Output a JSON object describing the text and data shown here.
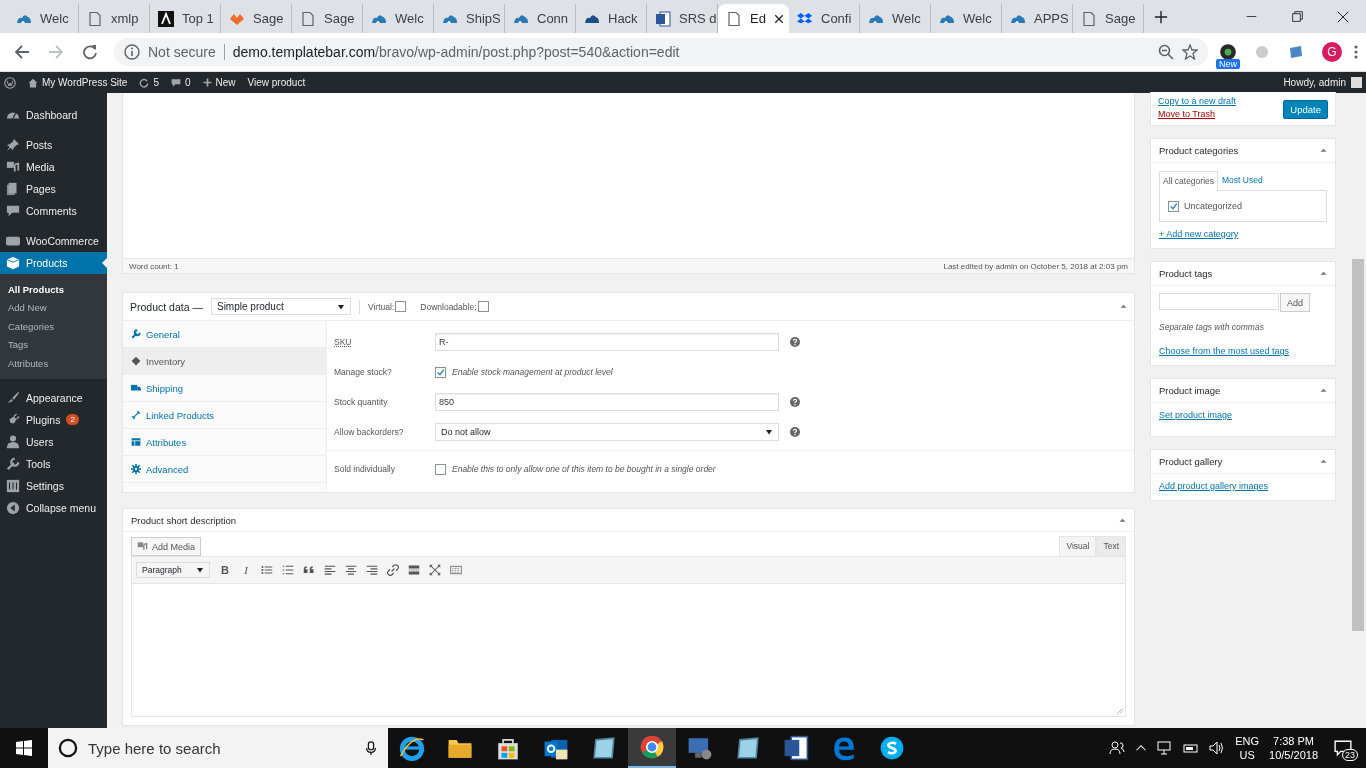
{
  "browser": {
    "tabs": [
      {
        "title": "Welc",
        "selected": false
      },
      {
        "title": "xmlp",
        "selected": false
      },
      {
        "title": "Top 1",
        "selected": false
      },
      {
        "title": "Sage",
        "selected": false
      },
      {
        "title": "Sage",
        "selected": false
      },
      {
        "title": "Welc",
        "selected": false
      },
      {
        "title": "ShipS",
        "selected": false
      },
      {
        "title": "Conn",
        "selected": false
      },
      {
        "title": "Hack",
        "selected": false
      },
      {
        "title": "SRS d",
        "selected": false
      },
      {
        "title": "Ed",
        "selected": true
      },
      {
        "title": "Confi",
        "selected": false
      },
      {
        "title": "Welc",
        "selected": false
      },
      {
        "title": "Welc",
        "selected": false
      },
      {
        "title": "APPS",
        "selected": false
      },
      {
        "title": "Sage",
        "selected": false
      }
    ],
    "security": "Not secure",
    "url_host": "demo.templatebar.com",
    "url_path": "/bravo/wp-admin/post.php?post=540&action=edit",
    "extension_badge": "New",
    "profile_initial": "G"
  },
  "admin_bar": {
    "site": "My WordPress Site",
    "updates": "5",
    "comments": "0",
    "new": "New",
    "view": "View product",
    "greeting": "Howdy, admin"
  },
  "sidebar": {
    "sections": [
      {
        "items": [
          {
            "label": "Dashboard",
            "selected": false
          }
        ]
      },
      {
        "items": [
          {
            "label": "Posts",
            "selected": false
          },
          {
            "label": "Media",
            "selected": false
          },
          {
            "label": "Pages",
            "selected": false
          },
          {
            "label": "Comments",
            "selected": false
          }
        ]
      },
      {
        "items": [
          {
            "label": "WooCommerce",
            "selected": false
          },
          {
            "label": "Products",
            "selected": true,
            "children": [
              {
                "label": "All Products",
                "selected": true
              },
              {
                "label": "Add New",
                "selected": false
              },
              {
                "label": "Categories",
                "selected": false
              },
              {
                "label": "Tags",
                "selected": false
              },
              {
                "label": "Attributes",
                "selected": false
              }
            ]
          }
        ]
      },
      {
        "items": [
          {
            "label": "Appearance",
            "selected": false
          },
          {
            "label": "Plugins",
            "selected": false,
            "badge": "2"
          },
          {
            "label": "Users",
            "selected": false
          },
          {
            "label": "Tools",
            "selected": false
          },
          {
            "label": "Settings",
            "selected": false
          },
          {
            "label": "Collapse menu",
            "selected": false
          }
        ]
      }
    ]
  },
  "editor": {
    "word_count": "Word count: 1",
    "last_edited": "Last edited by admin on October 5, 2018 at 2:03 pm"
  },
  "product_data": {
    "title": "Product data —",
    "type": "Simple product",
    "options": [
      {
        "label": "Virtual:",
        "checked": false
      },
      {
        "label": "Downloadable:",
        "checked": false
      }
    ],
    "tabs": [
      {
        "label": "General",
        "selected": false
      },
      {
        "label": "Inventory",
        "selected": true
      },
      {
        "label": "Shipping",
        "selected": false
      },
      {
        "label": "Linked Products",
        "selected": false
      },
      {
        "label": "Attributes",
        "selected": false
      },
      {
        "label": "Advanced",
        "selected": false
      }
    ],
    "groups": [
      [
        {
          "kind": "text",
          "label": "SKU",
          "value": "R-",
          "help": true
        },
        {
          "kind": "checkbox",
          "label": "Manage stock?",
          "checked": true,
          "description": "Enable stock management at product level",
          "help": false
        },
        {
          "kind": "text",
          "label": "Stock quantity",
          "value": "850",
          "help": true
        },
        {
          "kind": "select",
          "label": "Allow backorders?",
          "value": "Do not allow",
          "help": true
        }
      ],
      [
        {
          "kind": "checkbox",
          "label": "Sold individually",
          "checked": false,
          "description": "Enable this to only allow one of this item to be bought in a single order",
          "help": false
        }
      ]
    ]
  },
  "short_description": {
    "title": "Product short description",
    "add_media": "Add Media",
    "modes": [
      {
        "label": "Visual",
        "selected": true
      },
      {
        "label": "Text",
        "selected": false
      }
    ],
    "format": "Paragraph",
    "toolbar": [
      {
        "kind": "bold",
        "label": "B"
      },
      {
        "kind": "italic",
        "label": "I"
      },
      {
        "kind": "bullet-list"
      },
      {
        "kind": "numbered-list"
      },
      {
        "kind": "quote"
      },
      {
        "kind": "align-left"
      },
      {
        "kind": "align-center"
      },
      {
        "kind": "align-right"
      },
      {
        "kind": "link"
      },
      {
        "kind": "read-more"
      },
      {
        "kind": "fullscreen"
      },
      {
        "kind": "toolbar-toggle"
      }
    ]
  },
  "publish": {
    "copy": "Copy to a new draft",
    "trash": "Move to Trash",
    "update": "Update"
  },
  "categories": {
    "title": "Product categories",
    "tabs": [
      {
        "label": "All categories",
        "selected": true
      },
      {
        "label": "Most Used",
        "selected": false
      }
    ],
    "items": [
      {
        "label": "Uncategorized",
        "checked": true
      }
    ],
    "add_link": "+ Add new category"
  },
  "tags": {
    "title": "Product tags",
    "add": "Add",
    "hint": "Separate tags with commas",
    "choose_link": "Choose from the most used tags"
  },
  "product_image": {
    "title": "Product image",
    "link": "Set product image"
  },
  "product_gallery": {
    "title": "Product gallery",
    "link": "Add product gallery images"
  },
  "taskbar": {
    "search_placeholder": "Type here to search",
    "apps": [
      {
        "selected": false
      },
      {
        "selected": false
      },
      {
        "selected": false
      },
      {
        "selected": false
      },
      {
        "selected": false
      },
      {
        "selected": true
      },
      {
        "selected": false
      },
      {
        "selected": false
      },
      {
        "selected": false
      },
      {
        "selected": false
      },
      {
        "selected": false
      }
    ],
    "language": "ENG",
    "region": "US",
    "time": "7:38 PM",
    "date": "10/5/2018",
    "notifications": "23"
  }
}
